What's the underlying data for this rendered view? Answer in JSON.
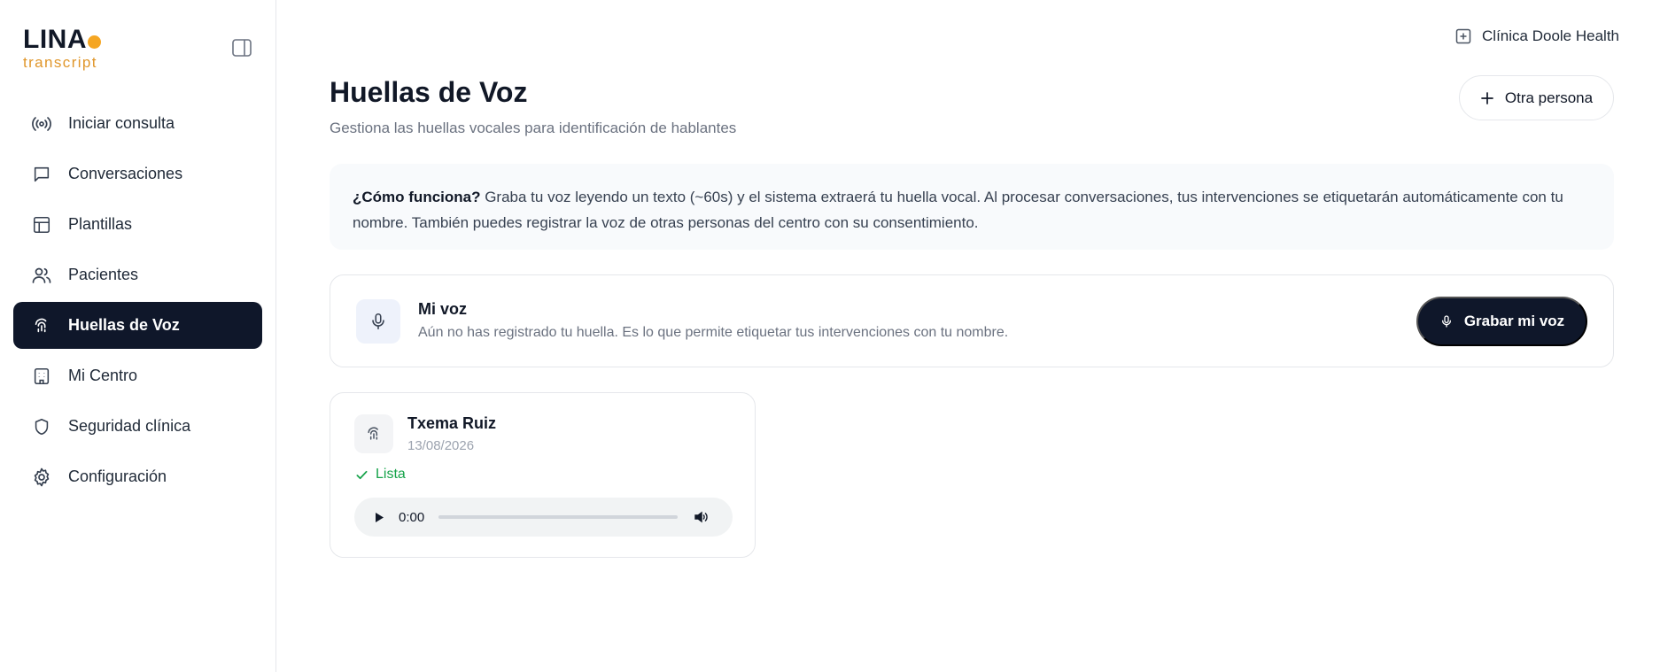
{
  "sidebar": {
    "logo": {
      "word": "LINA",
      "sub": "transcript"
    },
    "items": [
      {
        "label": "Iniciar consulta",
        "icon": "broadcast-icon",
        "active": false
      },
      {
        "label": "Conversaciones",
        "icon": "chat-bubble-icon",
        "active": false
      },
      {
        "label": "Plantillas",
        "icon": "layout-template-icon",
        "active": false
      },
      {
        "label": "Pacientes",
        "icon": "users-icon",
        "active": false
      },
      {
        "label": "Huellas de Voz",
        "icon": "fingerprint-icon",
        "active": true
      },
      {
        "label": "Mi Centro",
        "icon": "building-icon",
        "active": false
      },
      {
        "label": "Seguridad clínica",
        "icon": "shield-icon",
        "active": false
      },
      {
        "label": "Configuración",
        "icon": "gear-icon",
        "active": false
      }
    ]
  },
  "header": {
    "clinic_name": "Clínica Doole Health"
  },
  "main": {
    "title": "Huellas de Voz",
    "subtitle": "Gestiona las huellas vocales para identificación de hablantes",
    "add_person_label": "Otra persona",
    "info": {
      "strong": "¿Cómo funciona?",
      "text": " Graba tu voz leyendo un texto (~60s) y el sistema extraerá tu huella vocal. Al procesar conversaciones, tus intervenciones se etiquetarán automáticamente con tu nombre. También puedes registrar la voz de otras personas del centro con su consentimiento."
    },
    "my_voice": {
      "title": "Mi voz",
      "description": "Aún no has registrado tu huella. Es lo que permite etiquetar tus intervenciones con tu nombre.",
      "record_label": "Grabar mi voz"
    },
    "voiceprints": [
      {
        "name": "Txema Ruiz",
        "date": "13/08/2026",
        "status": "Lista",
        "audio_time": "0:00",
        "audio_progress": 0
      }
    ]
  },
  "colors": {
    "primary": "#0f172a",
    "accent": "#f5a623",
    "success": "#16a34a",
    "muted": "#6b7280"
  }
}
